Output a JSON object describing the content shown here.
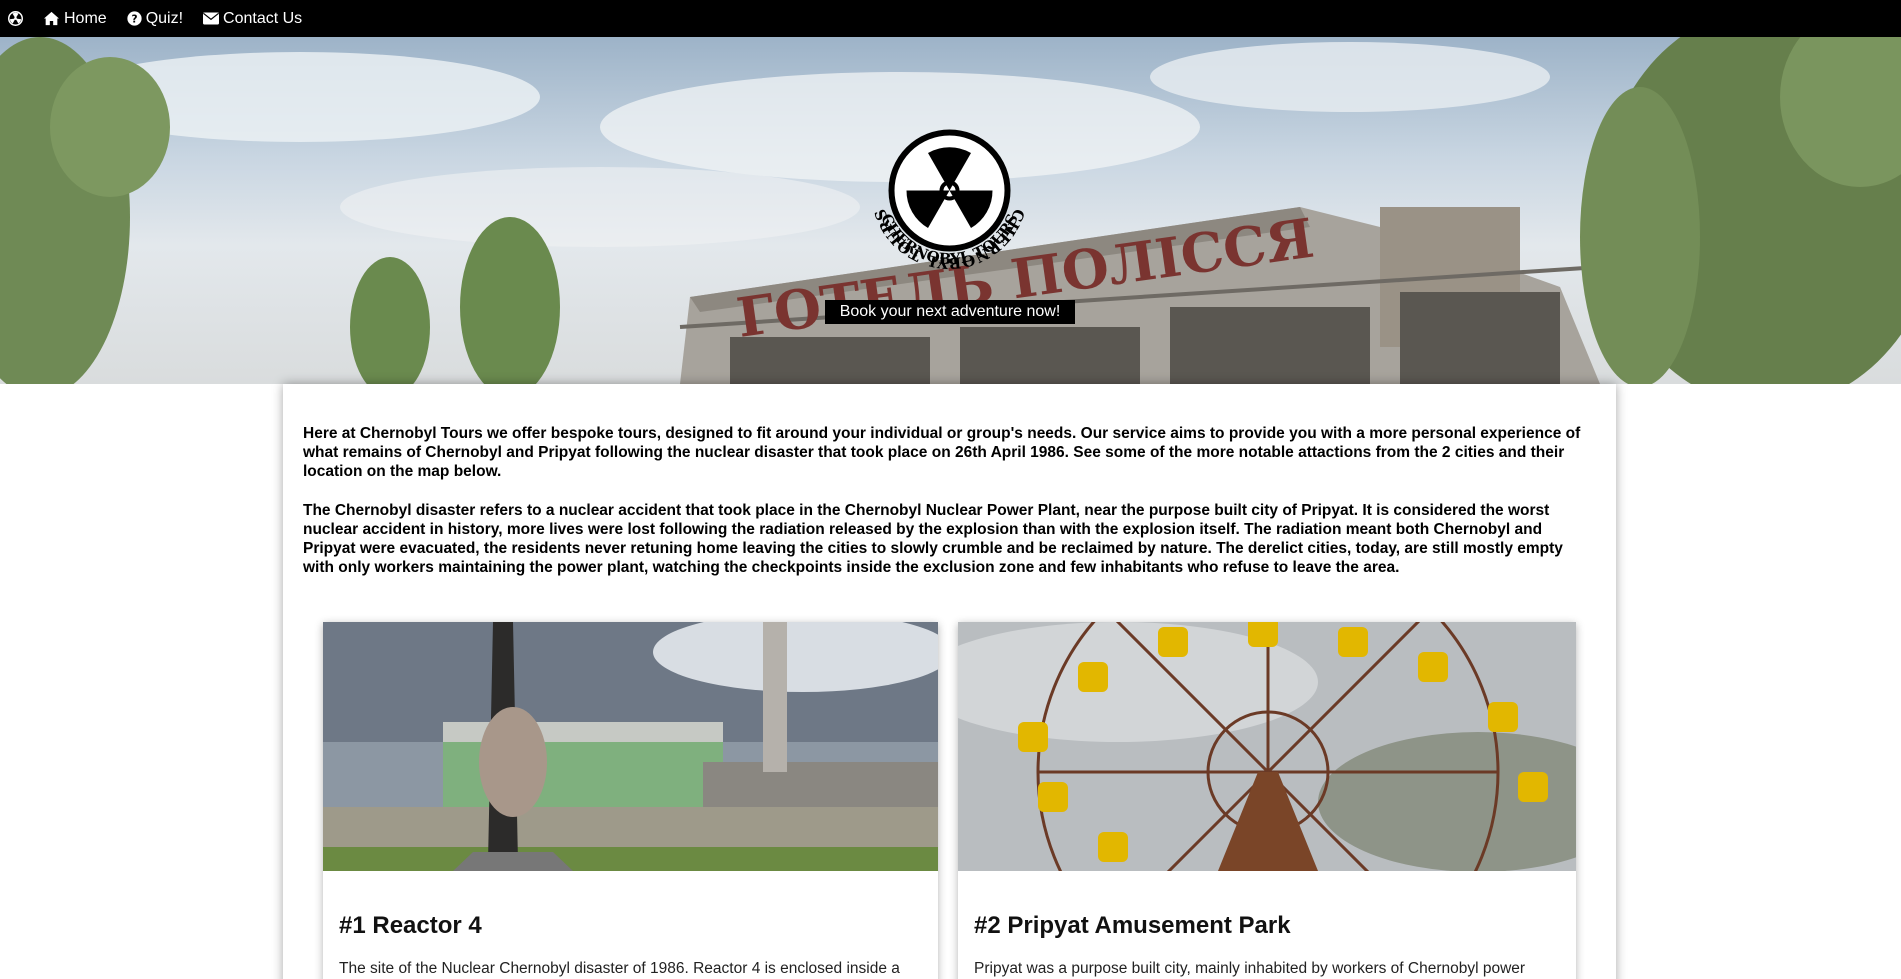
{
  "nav": {
    "brand_icon": "radiation-icon",
    "items": [
      {
        "label": "Home",
        "icon": "home-icon"
      },
      {
        "label": "Quiz!",
        "icon": "question-circle-icon"
      },
      {
        "label": "Contact Us",
        "icon": "envelope-icon"
      }
    ]
  },
  "hero": {
    "logo_text": "CHERNOBYL TOURS",
    "sign_text": "ГОТЕЛЬ ПОЛІССЯ",
    "cta_label": "Book your next adventure now!"
  },
  "intro": {
    "p1": "Here at Chernobyl Tours we offer bespoke tours, designed to fit around your individual or group's needs. Our service aims to provide you with a more personal experience of what remains of Chernobyl and Pripyat following the nuclear disaster that took place on 26th April 1986. See some of the more notable attactions from the 2 cities and their location on the map below.",
    "p2": "The Chernobyl disaster refers to a nuclear accident that took place in the Chernobyl Nuclear Power Plant, near the purpose built city of Pripyat. It is considered the worst nuclear accident in history, more lives were lost following the radiation released by the explosion than with the explosion itself. The radiation meant both Chernobyl and Pripyat were evacuated, the residents never retuning home leaving the cities to slowly crumble and be reclaimed by nature. The derelict cities, today, are still mostly empty with only workers maintaining the power plant, watching the checkpoints inside the exclusion zone and few inhabitants who refuse to leave the area."
  },
  "attractions": [
    {
      "title": "#1 Reactor 4",
      "text": "The site of the Nuclear Chernobyl disaster of 1986. Reactor 4 is enclosed inside a"
    },
    {
      "title": "#2 Pripyat Amusement Park",
      "text": "Pripyat was a purpose built city, mainly inhabited by workers of Chernobyl power"
    }
  ],
  "colors": {
    "nav_bg": "#000000",
    "cta_bg": "#000000",
    "text": "#000000"
  }
}
